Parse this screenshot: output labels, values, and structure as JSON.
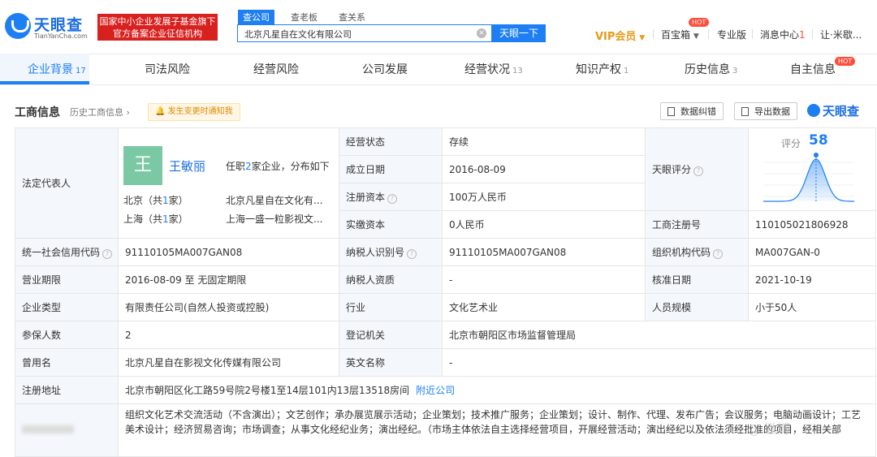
{
  "header": {
    "logo_text": "天眼查",
    "logo_sub": "TianYanCha.com",
    "badge_line1": "国家中小企业发展子基金旗下",
    "badge_line2": "官方备案企业征信机构",
    "search_tabs": [
      "查公司",
      "查老板",
      "查关系"
    ],
    "search_value": "北京凡星自在文化有限公司",
    "search_button": "天眼一下",
    "vip": "VIP会员",
    "baibaoxiang": "百宝箱",
    "hot": "HOT",
    "pro": "专业版",
    "msg": "消息中心",
    "msg_count": "1",
    "user": "让·米歇..."
  },
  "tabs": [
    {
      "label": "企业背景",
      "count": "17"
    },
    {
      "label": "司法风险",
      "count": ""
    },
    {
      "label": "经营风险",
      "count": ""
    },
    {
      "label": "公司发展",
      "count": ""
    },
    {
      "label": "经营状况",
      "count": "13"
    },
    {
      "label": "知识产权",
      "count": "1"
    },
    {
      "label": "历史信息",
      "count": "3"
    },
    {
      "label": "自主信息",
      "count": ""
    }
  ],
  "section": {
    "title": "工商信息",
    "history": "历史工商信息",
    "notify": "发生变更时通知我",
    "btn_correct": "数据纠错",
    "btn_export": "导出数据",
    "brand": "天眼查"
  },
  "legal": {
    "label": "法定代表人",
    "avatar": "王",
    "name": "王敏丽",
    "info_pre": "任职",
    "info_num": "2",
    "info_post": "家企业，分布如下",
    "r1_city": "北京（共",
    "r1_num": "1",
    "r1_end": "家）",
    "r1_co": "北京凡星自在文化有...",
    "r2_city": "上海（共",
    "r2_num": "1",
    "r2_end": "家）",
    "r2_co": "上海一盛一粒影视文..."
  },
  "score": {
    "label": "天眼评分",
    "title": "评分",
    "value": "58",
    "value_num": 58
  },
  "rows": {
    "status_l": "经营状态",
    "status_v": "存续",
    "found_l": "成立日期",
    "found_v": "2016-08-09",
    "capital_l": "注册资本",
    "capital_v": "100万人民币",
    "paid_l": "实缴资本",
    "paid_v": "0人民币",
    "regno_l": "工商注册号",
    "regno_v": "110105021806928",
    "credit_l": "统一社会信用代码",
    "credit_v": "91110105MA007GAN08",
    "tax_l": "纳税人识别号",
    "tax_v": "91110105MA007GAN08",
    "org_l": "组织机构代码",
    "org_v": "MA007GAN-0",
    "term_l": "营业期限",
    "term_v": "2016-08-09 至 无固定期限",
    "taxq_l": "纳税人资质",
    "taxq_v": "-",
    "approve_l": "核准日期",
    "approve_v": "2021-10-19",
    "type_l": "企业类型",
    "type_v": "有限责任公司(自然人投资或控股)",
    "industry_l": "行业",
    "industry_v": "文化艺术业",
    "staff_l": "人员规模",
    "staff_v": "小于50人",
    "insured_l": "参保人数",
    "insured_v": "2",
    "regorg_l": "登记机关",
    "regorg_v": "北京市朝阳区市场监督管理局",
    "former_l": "曾用名",
    "former_v": "北京凡星自在影视文化传媒有限公司",
    "en_l": "英文名称",
    "en_v": "-",
    "addr_l": "注册地址",
    "addr_v": "北京市朝阳区化工路59号院2号楼1至14层101内13层13518房间",
    "addr_link": "附近公司",
    "scope_v": "组织文化艺术交流活动（不含演出）；文艺创作；承办展览展示活动；企业策划；技术推广服务；企业策划；设计、制作、代理、发布广告；会议服务；电脑动画设计；工艺美术设计；经济贸易咨询；市场调查；从事文化经纪业务；演出经纪。（市场主体依法自主选择经营项目，开展经营活动；演出经纪以及依法须经批准的项目，经相关部"
  },
  "colors": {
    "brand": "#1d7ff2",
    "red": "#d8201f",
    "label_bg": "#f4f7fb"
  }
}
